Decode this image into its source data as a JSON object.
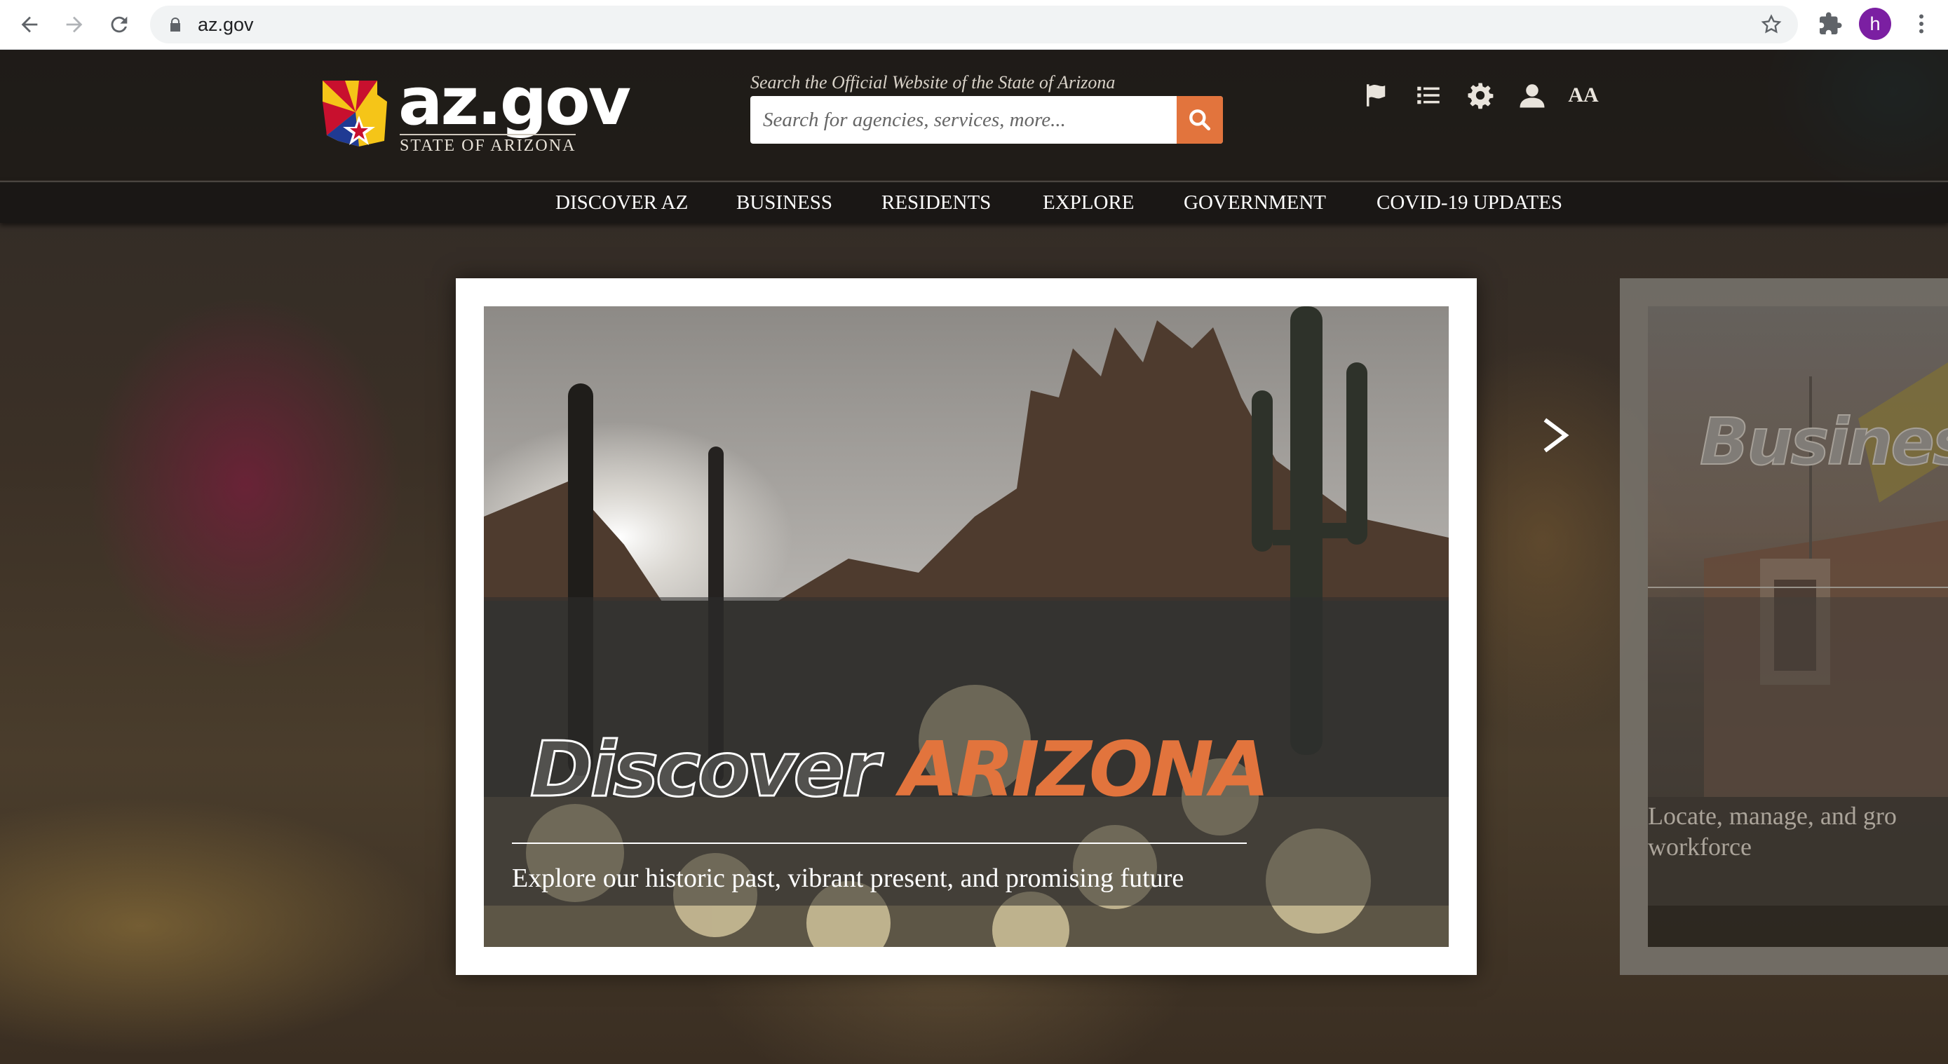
{
  "browser": {
    "url": "az.gov",
    "profile_initial": "h",
    "icons": [
      "back-icon",
      "forward-icon",
      "reload-icon",
      "lock-icon",
      "bookmark-star-icon",
      "extensions-icon",
      "menu-dots-icon"
    ]
  },
  "header": {
    "logo_word": "az.gov",
    "logo_sub": "STATE OF ARIZONA",
    "search_label": "Search the Official Website of the State of Arizona",
    "search_placeholder": "Search for agencies, services, more...",
    "tools": [
      "flag-icon",
      "list-icon",
      "gear-icon",
      "user-icon",
      "text-size-icon"
    ],
    "text_size_label": "AA",
    "colors": {
      "accent": "#e2743d",
      "header_bg": "#1e1b19"
    }
  },
  "nav": {
    "items": [
      {
        "label": "DISCOVER AZ"
      },
      {
        "label": "BUSINESS"
      },
      {
        "label": "RESIDENTS"
      },
      {
        "label": "EXPLORE"
      },
      {
        "label": "GOVERNMENT"
      },
      {
        "label": "COVID-19 UPDATES"
      }
    ]
  },
  "carousel": {
    "slides": [
      {
        "title_part1": "Discover",
        "title_part2": "ARIZONA",
        "subtitle": "Explore our historic past, vibrant present, and promising future"
      },
      {
        "title_part1": "Business",
        "subtitle": "Locate, manage, and gro workforce"
      }
    ],
    "next_icon": "chevron-right-icon"
  }
}
